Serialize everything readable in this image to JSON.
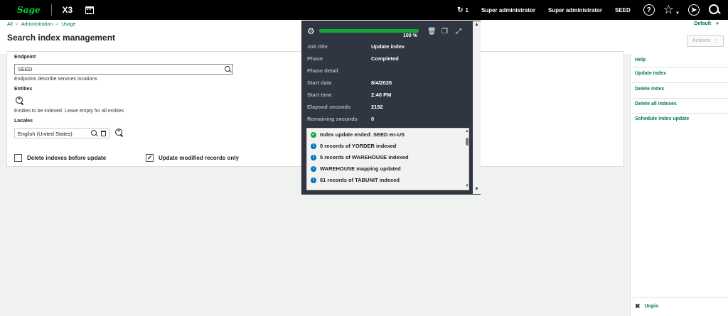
{
  "topbar": {
    "logo": "Sage",
    "product": "X3",
    "notif_count": "1",
    "user1": "Super administrator",
    "user2": "Super administrator",
    "folder": "SEED",
    "help_glyph": "?"
  },
  "breadcrumb": [
    "All",
    "Administration",
    "Usage"
  ],
  "page": {
    "title": "Search index management",
    "default_label": "Default",
    "actions_label": "Actions"
  },
  "form": {
    "endpoint_label": "Endpoint",
    "endpoint_value": "SEED",
    "endpoint_help": "Endpoints describe services locations",
    "entities_label": "Entities",
    "entities_help": "Entities to be indexed. Leave empty for all entities",
    "locales_label": "Locales",
    "locale_value": "English (United States)",
    "delete_before_label": "Delete indexes before update",
    "delete_before_checked": false,
    "update_modified_label": "Update modified records only",
    "update_modified_checked": true
  },
  "right_panel": {
    "items": [
      "Help",
      "Update index",
      "Delete index",
      "Delete all indexes",
      "Schedule index update"
    ],
    "unpin": "Unpin"
  },
  "popup": {
    "progress_percent": 100,
    "progress_label": "100 %",
    "rows": [
      {
        "label": "Job title",
        "value": "Update index"
      },
      {
        "label": "Phase",
        "value": "Completed"
      },
      {
        "label": "Phase detail",
        "value": ""
      },
      {
        "label": "Start date",
        "value": "8/4/2026"
      },
      {
        "label": "Start time",
        "value": "2:40 PM"
      },
      {
        "label": "Elapsed seconds",
        "value": "2192"
      },
      {
        "label": "Remaining seconds",
        "value": "0"
      }
    ],
    "log": [
      {
        "type": "success",
        "text": "Index update ended: SEED en-US"
      },
      {
        "type": "info",
        "text": "0 records of YORDER indexed"
      },
      {
        "type": "info",
        "text": "5 records of WAREHOUSE indexed"
      },
      {
        "type": "info",
        "text": "WAREHOUSE mapping updated"
      },
      {
        "type": "info",
        "text": "61 records of TABUNIT indexed"
      }
    ]
  },
  "colors": {
    "brand_green": "#00d639",
    "link_green": "#007e45",
    "progress_green": "#12a83a",
    "info_blue": "#0073c2",
    "popup_bg": "#2f3541"
  }
}
